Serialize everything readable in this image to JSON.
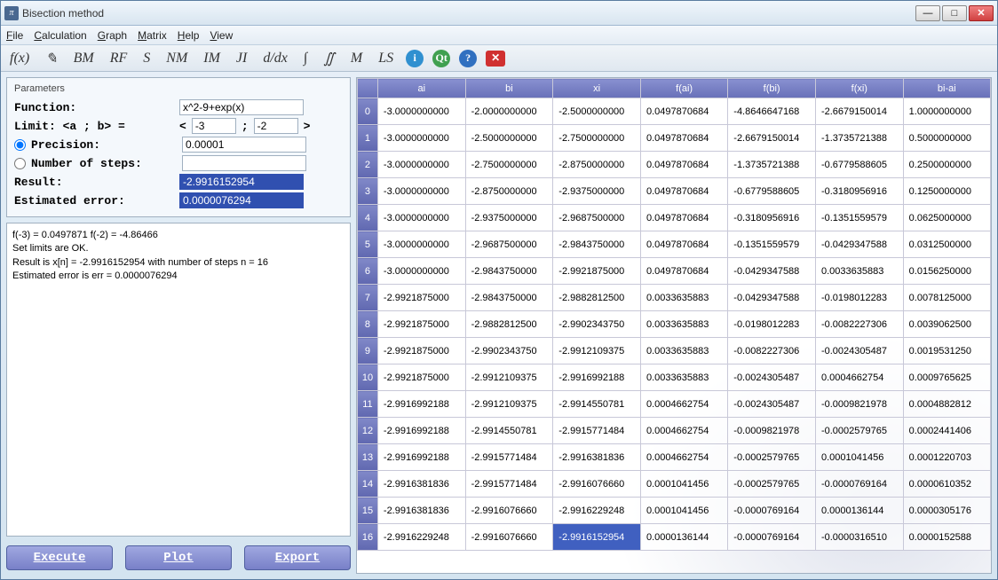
{
  "window": {
    "title": "Bisection method"
  },
  "menu": [
    "File",
    "Calculation",
    "Graph",
    "Matrix",
    "Help",
    "View"
  ],
  "toolbar": [
    "f(x)",
    "~",
    "BM",
    "RF",
    "S",
    "NM",
    "IM",
    "JI",
    "d/dx",
    "∫",
    "∬",
    "M",
    "LS"
  ],
  "params": {
    "header": "Parameters",
    "function_label": "Function:",
    "function_value": "x^2-9+exp(x)",
    "limit_label": "Limit: <a ; b>  =",
    "limit_lt": "<",
    "limit_a": "-3",
    "limit_sep": ";",
    "limit_b": "-2",
    "limit_gt": ">",
    "precision_label": "Precision:",
    "precision_value": "0.00001",
    "steps_label": "Number of steps:",
    "steps_value": "",
    "result_label": "Result:",
    "result_value": "-2.9916152954",
    "error_label": "Estimated error:",
    "error_value": "0.0000076294"
  },
  "log": "f(-3) = 0.0497871    f(-2) = -4.86466\nSet limits are OK.\nResult is x[n] = -2.9916152954    with number of steps n = 16\nEstimated error is err = 0.0000076294",
  "buttons": {
    "execute": "Execute",
    "plot": "Plot",
    "export": "Export"
  },
  "table": {
    "headers": [
      "ai",
      "bi",
      "xi",
      "f(ai)",
      "f(bi)",
      "f(xi)",
      "bi-ai"
    ],
    "rows": [
      [
        "-3.0000000000",
        "-2.0000000000",
        "-2.5000000000",
        "0.0497870684",
        "-4.8646647168",
        "-2.6679150014",
        "1.0000000000"
      ],
      [
        "-3.0000000000",
        "-2.5000000000",
        "-2.7500000000",
        "0.0497870684",
        "-2.6679150014",
        "-1.3735721388",
        "0.5000000000"
      ],
      [
        "-3.0000000000",
        "-2.7500000000",
        "-2.8750000000",
        "0.0497870684",
        "-1.3735721388",
        "-0.6779588605",
        "0.2500000000"
      ],
      [
        "-3.0000000000",
        "-2.8750000000",
        "-2.9375000000",
        "0.0497870684",
        "-0.6779588605",
        "-0.3180956916",
        "0.1250000000"
      ],
      [
        "-3.0000000000",
        "-2.9375000000",
        "-2.9687500000",
        "0.0497870684",
        "-0.3180956916",
        "-0.1351559579",
        "0.0625000000"
      ],
      [
        "-3.0000000000",
        "-2.9687500000",
        "-2.9843750000",
        "0.0497870684",
        "-0.1351559579",
        "-0.0429347588",
        "0.0312500000"
      ],
      [
        "-3.0000000000",
        "-2.9843750000",
        "-2.9921875000",
        "0.0497870684",
        "-0.0429347588",
        "0.0033635883",
        "0.0156250000"
      ],
      [
        "-2.9921875000",
        "-2.9843750000",
        "-2.9882812500",
        "0.0033635883",
        "-0.0429347588",
        "-0.0198012283",
        "0.0078125000"
      ],
      [
        "-2.9921875000",
        "-2.9882812500",
        "-2.9902343750",
        "0.0033635883",
        "-0.0198012283",
        "-0.0082227306",
        "0.0039062500"
      ],
      [
        "-2.9921875000",
        "-2.9902343750",
        "-2.9912109375",
        "0.0033635883",
        "-0.0082227306",
        "-0.0024305487",
        "0.0019531250"
      ],
      [
        "-2.9921875000",
        "-2.9912109375",
        "-2.9916992188",
        "0.0033635883",
        "-0.0024305487",
        "0.0004662754",
        "0.0009765625"
      ],
      [
        "-2.9916992188",
        "-2.9912109375",
        "-2.9914550781",
        "0.0004662754",
        "-0.0024305487",
        "-0.0009821978",
        "0.0004882812"
      ],
      [
        "-2.9916992188",
        "-2.9914550781",
        "-2.9915771484",
        "0.0004662754",
        "-0.0009821978",
        "-0.0002579765",
        "0.0002441406"
      ],
      [
        "-2.9916992188",
        "-2.9915771484",
        "-2.9916381836",
        "0.0004662754",
        "-0.0002579765",
        "0.0001041456",
        "0.0001220703"
      ],
      [
        "-2.9916381836",
        "-2.9915771484",
        "-2.9916076660",
        "0.0001041456",
        "-0.0002579765",
        "-0.0000769164",
        "0.0000610352"
      ],
      [
        "-2.9916381836",
        "-2.9916076660",
        "-2.9916229248",
        "0.0001041456",
        "-0.0000769164",
        "0.0000136144",
        "0.0000305176"
      ],
      [
        "-2.9916229248",
        "-2.9916076660",
        "-2.9916152954",
        "0.0000136144",
        "-0.0000769164",
        "-0.0000316510",
        "0.0000152588"
      ]
    ],
    "selected": {
      "row": 16,
      "col": 2
    }
  }
}
